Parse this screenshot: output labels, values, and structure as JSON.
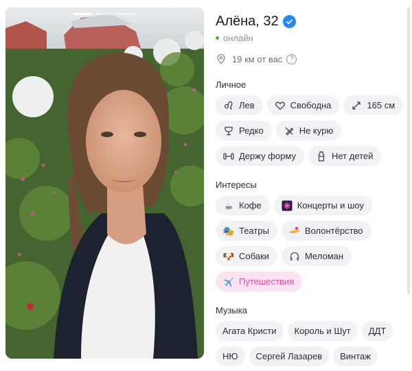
{
  "profile": {
    "name": "Алёна, 32",
    "status": "онлайн",
    "distance": "19 км от вас"
  },
  "sections": {
    "personal": {
      "title": "Личное",
      "chips": [
        {
          "label": "Лев",
          "icon": "leo-icon"
        },
        {
          "label": "Свободна",
          "icon": "heart-icon"
        },
        {
          "label": "165 см",
          "icon": "height-icon"
        },
        {
          "label": "Редко",
          "icon": "glass-icon"
        },
        {
          "label": "Не курю",
          "icon": "no-smoking-icon"
        },
        {
          "label": "Держу форму",
          "icon": "dumbbell-icon"
        },
        {
          "label": "Нет детей",
          "icon": "bottle-icon"
        }
      ]
    },
    "interests": {
      "title": "Интересы",
      "chips": [
        {
          "label": "Кофе",
          "icon": "coffee-icon"
        },
        {
          "label": "Концерты и шоу",
          "icon": "fireworks-icon"
        },
        {
          "label": "Театры",
          "icon": "theater-icon"
        },
        {
          "label": "Волонтёрство",
          "icon": "volunteer-icon"
        },
        {
          "label": "Собаки",
          "icon": "dog-icon"
        },
        {
          "label": "Меломан",
          "icon": "headphones-icon"
        },
        {
          "label": "Путешествия",
          "icon": "plane-icon"
        }
      ]
    },
    "music": {
      "title": "Музыка",
      "chips": [
        {
          "label": "Агата Кристи"
        },
        {
          "label": "Король и Шут"
        },
        {
          "label": "ДДТ"
        },
        {
          "label": "НЮ"
        },
        {
          "label": "Сергей Лазарев"
        },
        {
          "label": "Винтаж"
        }
      ]
    }
  },
  "colors": {
    "accent_chip_bg": "#fbe3f1",
    "accent_chip_text": "#e64ba0",
    "verified": "#2787f5",
    "online": "#4bb34b",
    "chip_bg": "#f0f2f5"
  }
}
